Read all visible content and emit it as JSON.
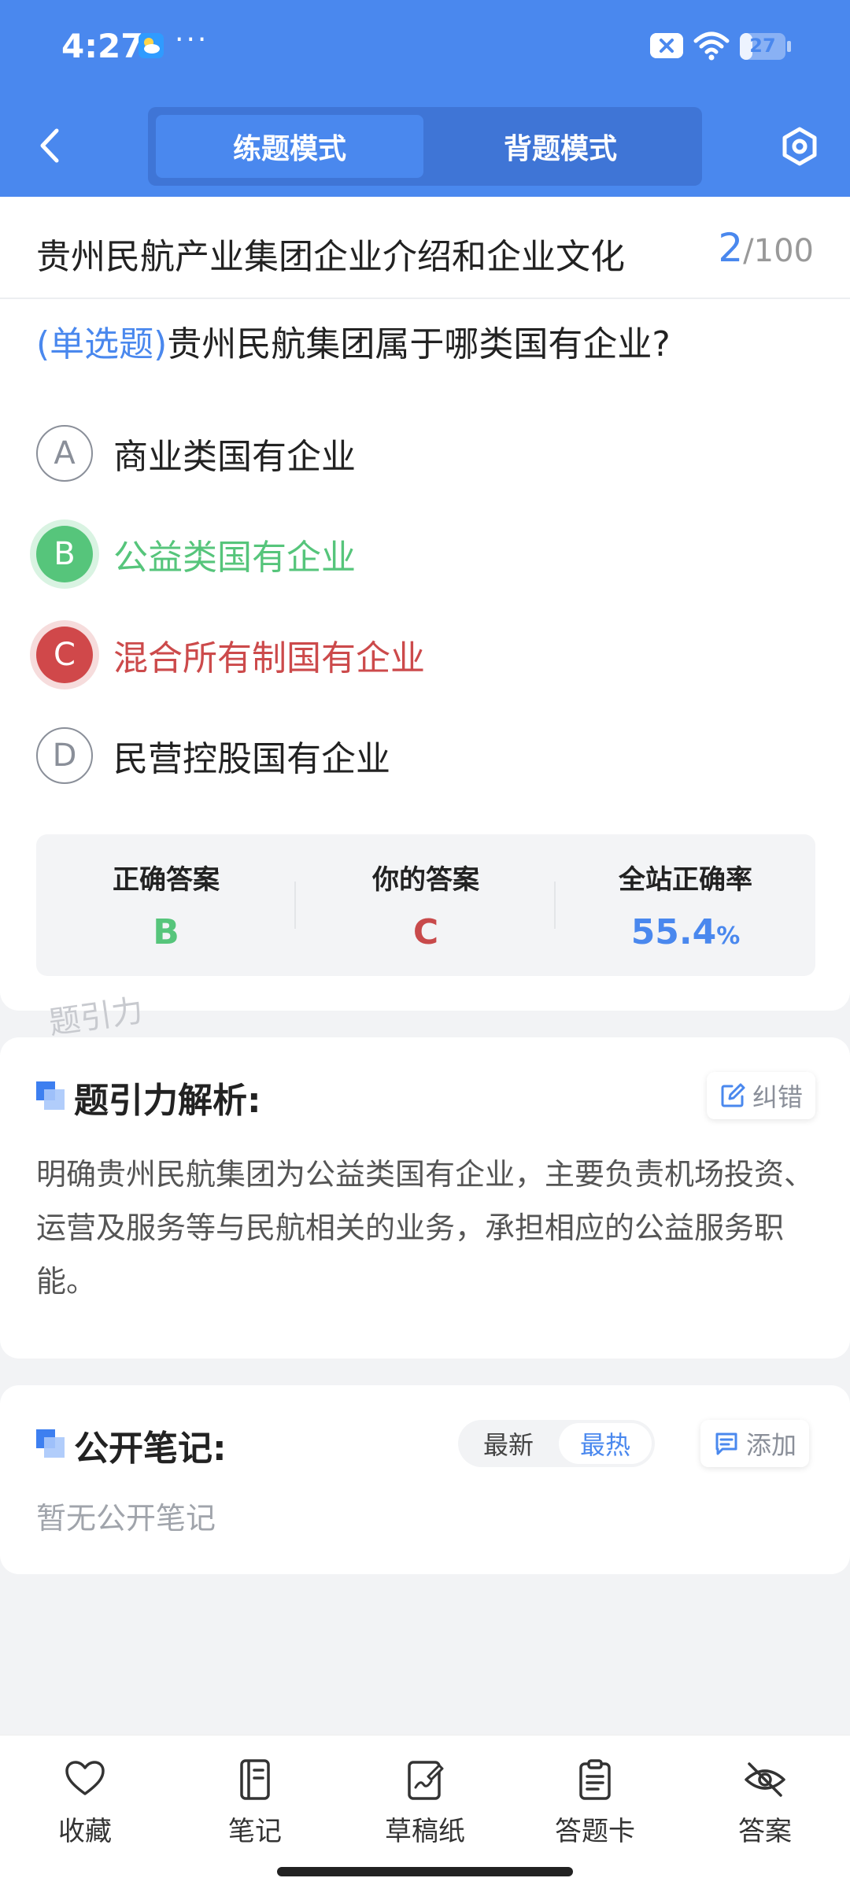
{
  "status_bar": {
    "time": "4:27",
    "battery": "27",
    "battery_level": 0.27
  },
  "nav": {
    "modes": [
      "练题模式",
      "背题模式"
    ],
    "active_mode": "练题模式"
  },
  "quiz": {
    "title": "贵州民航产业集团企业介绍和企业文化",
    "current": "2",
    "total_text": "/100",
    "question_type": "(单选题)",
    "question_text": "贵州民航集团属于哪类国有企业?",
    "options": [
      {
        "letter": "A",
        "text": "商业类国有企业",
        "state": "normal"
      },
      {
        "letter": "B",
        "text": "公益类国有企业",
        "state": "correct"
      },
      {
        "letter": "C",
        "text": "混合所有制国有企业",
        "state": "wrong"
      },
      {
        "letter": "D",
        "text": "民营控股国有企业",
        "state": "normal"
      }
    ],
    "stats": {
      "correct_label": "正确答案",
      "correct_value": "B",
      "yours_label": "你的答案",
      "yours_value": "C",
      "rate_label": "全站正确率",
      "rate_value": "55.4",
      "rate_unit": "%"
    },
    "watermark": "题引力"
  },
  "analysis": {
    "title": "题引力解析:",
    "report_label": "纠错",
    "text": "明确贵州民航集团为公益类国有企业，主要负责机场投资、运营及服务等与民航相关的业务，承担相应的公益服务职能。"
  },
  "notes": {
    "title": "公开笔记:",
    "sort_newest": "最新",
    "sort_hot": "最热",
    "add_label": "添加",
    "empty_text": "暂无公开笔记"
  },
  "bottom_bar": [
    {
      "label": "收藏",
      "icon": "heart-icon"
    },
    {
      "label": "笔记",
      "icon": "notebook-icon"
    },
    {
      "label": "草稿纸",
      "icon": "draft-paper-icon"
    },
    {
      "label": "答题卡",
      "icon": "answer-card-icon"
    },
    {
      "label": "答案",
      "icon": "eye-off-icon"
    }
  ],
  "colors": {
    "primary": "#4a88ee",
    "correct": "#56c57b",
    "wrong": "#d0484a"
  }
}
